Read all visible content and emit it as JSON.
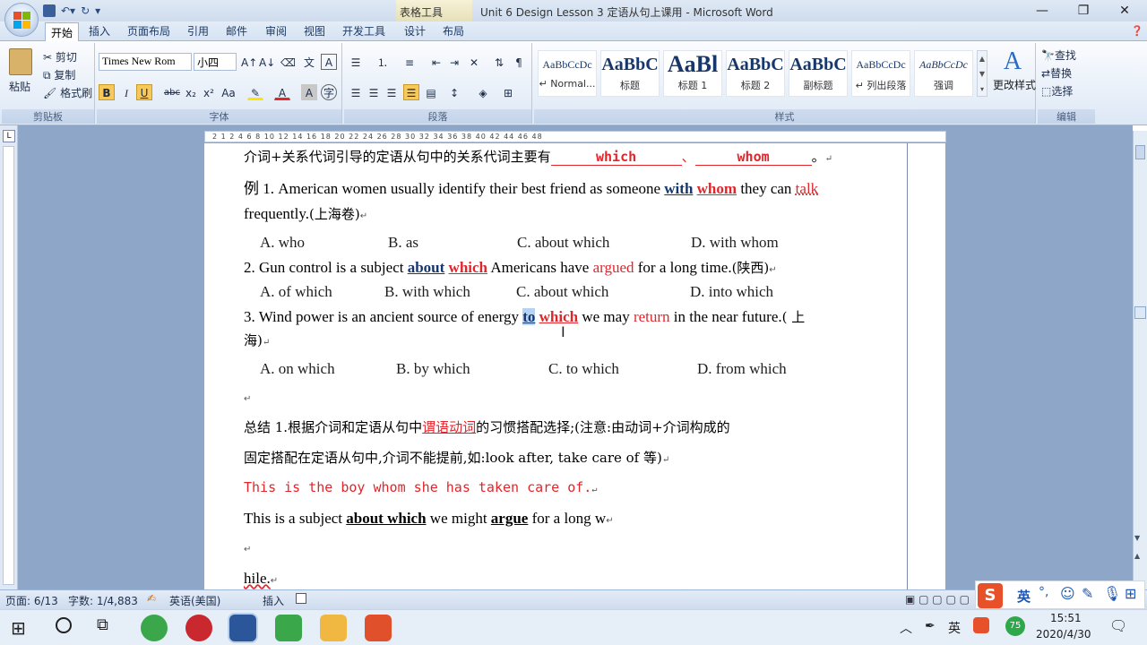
{
  "window": {
    "title": "Unit 6 Design Lesson 3 定语从句上课用 - Microsoft Word",
    "context_tab": "表格工具"
  },
  "tabs": [
    "开始",
    "插入",
    "页面布局",
    "引用",
    "邮件",
    "审阅",
    "视图",
    "开发工具",
    "设计",
    "布局"
  ],
  "clipboard": {
    "paste": "粘贴",
    "cut": "剪切",
    "copy": "复制",
    "format_painter": "格式刷",
    "label": "剪贴板"
  },
  "font": {
    "name": "Times New Rom",
    "size": "小四",
    "label": "字体"
  },
  "paragraph": {
    "label": "段落"
  },
  "styles": {
    "label": "样式",
    "items": [
      {
        "preview": "AaBbCcDc",
        "name": "↵ Normal..."
      },
      {
        "preview": "AaBbC",
        "name": "标题"
      },
      {
        "preview": "AaBl",
        "name": "标题 1"
      },
      {
        "preview": "AaBbC",
        "name": "标题 2"
      },
      {
        "preview": "AaBbC",
        "name": "副标题"
      },
      {
        "preview": "AaBbCcDc",
        "name": "↵ 列出段落"
      },
      {
        "preview": "AaBbCcDc",
        "name": "强调"
      }
    ],
    "change_styles": "更改样式"
  },
  "editing": {
    "find": "查找",
    "replace": "替换",
    "select": "选择",
    "label": "编辑"
  },
  "ruler_numbers": "2 1 2 4 6 8 10 12 14 16 18 20 22 24 26 28 30 32 34 36 38 40 42 44 46 48",
  "document": {
    "l1": {
      "a": "介词+关系代词引导的定语从句中的关系代词主要有",
      "b1": "which",
      "sep": "、",
      "b2": "whom",
      "end": "。"
    },
    "q1": {
      "pre": "例 1. American women usually identify their best friend as someone ",
      "ans1": "with",
      "ans2": "whom",
      "mid": " they can ",
      "verb": "talk",
      "cont": "frequently.",
      "src": "(上海卷)"
    },
    "q1opts": [
      "A. who",
      "B. as",
      "C. about which",
      "D. with whom"
    ],
    "q2": {
      "pre": "2. Gun control is a subject ",
      "ans1": "about",
      "ans2": "which",
      "mid": " Americans have ",
      "verb": "argued",
      "post": " for a long time.",
      "src": "(陕西)"
    },
    "q2opts": [
      "A. of which",
      "B. with which",
      "C. about which",
      "D. into which"
    ],
    "q3": {
      "pre": "3. Wind power is an ancient source of energy ",
      "ans1": "to",
      "ans2": "which",
      "mid": " we may ",
      "verb": "return",
      "post": " in the near future.",
      "src1": "( 上",
      "src2": "海)"
    },
    "q3opts": [
      "A. on which",
      "B. by which",
      "C. to which",
      "D. from which"
    ],
    "sum": {
      "lead": "总结 1.根据介词和定语从句中",
      "key": "谓语动词",
      "rest": "的习惯搭配选择;(注意:由动词+介词构成的",
      "line2": "固定搭配在定语从句中,介词不能提前,如:look after, take care of 等)"
    },
    "example": "This is the boy whom she has taken care of.",
    "ex2": {
      "pre": "This is a subject",
      "ans": "about which",
      "mid": " we might",
      "verb": "argue",
      "post": " for a long w"
    },
    "ex2end": "hile."
  },
  "status": {
    "page": "页面: 6/13",
    "words": "字数: 1/4,883",
    "lang": "英语(美国)",
    "mode": "插入"
  },
  "ime": {
    "lang": "英",
    "sep": "°,"
  },
  "tray": {
    "lang": "英",
    "badge": "75",
    "time": "15:51",
    "date": "2020/4/30"
  },
  "colors": {
    "accent_red": "#e0262b",
    "navy": "#16366e",
    "word_blue": "#2b579a"
  }
}
